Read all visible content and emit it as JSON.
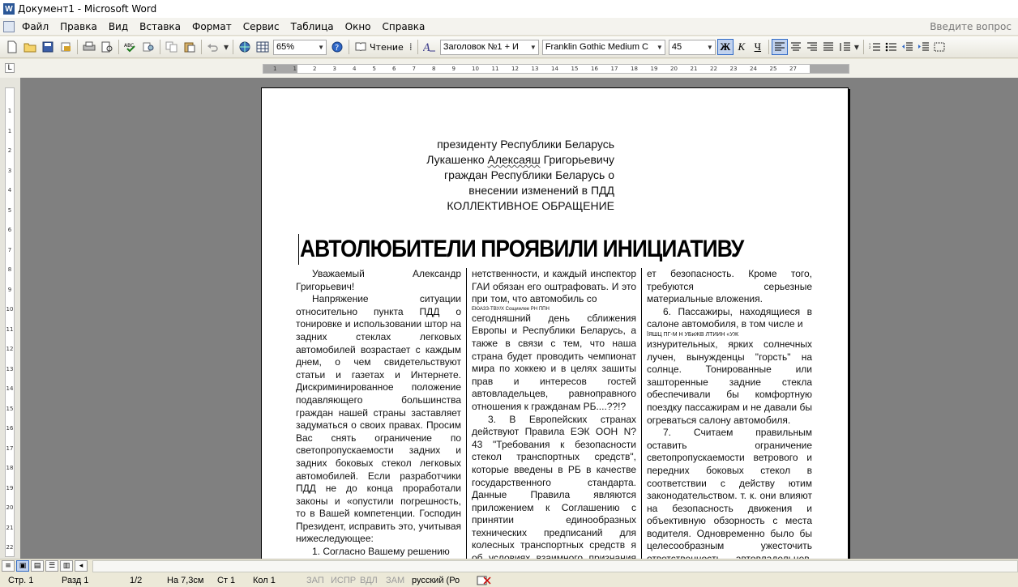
{
  "window": {
    "title": "Документ1 - Microsoft Word"
  },
  "menu": {
    "items": [
      "Файл",
      "Правка",
      "Вид",
      "Вставка",
      "Формат",
      "Сервис",
      "Таблица",
      "Окно",
      "Справка"
    ],
    "help_placeholder": "Введите вопрос"
  },
  "toolbar": {
    "zoom": "65%",
    "read_label": "Чтение",
    "style": "Заголовок №1 + И",
    "font": "Franklin Gothic Medium C",
    "size": "45",
    "bold": "Ж",
    "italic": "К",
    "underline": "Ч"
  },
  "ruler": {
    "ticks": [
      "1",
      "1",
      "2",
      "3",
      "4",
      "5",
      "6",
      "7",
      "8",
      "9",
      "10",
      "11",
      "12",
      "13",
      "14",
      "15",
      "16",
      "17",
      "18",
      "19",
      "20",
      "21",
      "22",
      "23",
      "24",
      "25",
      "27"
    ],
    "vticks": [
      "1",
      "1",
      "2",
      "3",
      "4",
      "5",
      "6",
      "7",
      "8",
      "9",
      "10",
      "11",
      "12",
      "13",
      "14",
      "15",
      "16",
      "17",
      "18",
      "19",
      "20",
      "21",
      "22"
    ]
  },
  "document": {
    "header_lines": [
      "президенту Республики Беларусь",
      "Лукашенко Алексаяш Григорьевичу",
      "граждан Республики Беларусь о",
      "внесении изменений в ПДД",
      "КОЛЛЕКТИВНОЕ ОБРАЩЕНИЕ"
    ],
    "headline": "АВТОЛЮБИТЕЛИ ПРОЯВИЛИ ИНИЦИАТИВУ",
    "col1": {
      "p1": "Уважаемый Александр Григорьевич!",
      "p2": "Напряжение ситуации относительно пункта ПДД о тонировке и использовании штор на задних стеклах легковых автомобилей возрастает с каждым днем, о чем свидетельствуют статьи и газетах и Интернете. Дискриминированное положение подавляющего большинства граждан нашей страны заставляет задуматься о своих правах. Просим Вас снять ограничение по светопропускаемости задних и задних боковых стекол легковых автомобилей. Если разработчики ПДД не до конца проработали законы и «опустили погрешность, то в Вашей компетенции. Господин Президент, исправить это, учитывая нижеследующее:",
      "p3": "1. Согласно Вашему решению"
    },
    "col2": {
      "p1": "нетственности, и каждый инспектор ГАИ обязан его оштрафовать. И это при том, что автомобиль со",
      "garbled": "ЕЮАЗЗ-ТВУ/X Сощиилее РН ППН",
      "p2": "сегодняшний день сближения Европы и Республики Беларусь, а также в связи с тем, что наша страна будет проводить чемпионат мира по хоккею и в целях зашиты прав и интересов гостей автовладельцев, равноправного отношения к гражданам РБ....??!?",
      "p3": "3. В Европейских странах действуют Правила ЕЭК ООН N? 43 \"Требования к безопасности стекол транспортных средств\", которые введены в РБ в качестве государственного стандарта. Данные Правила являются приложением к Соглашению с принятии единообразных технических предписаний для колесных транспортных средств я об условиях взаимного признания официальных утвер-"
    },
    "col3": {
      "p1": "ет безопасность. Кроме того, требуются серьезные материальные вложения.",
      "p2": "6. Пассажиры, находящиеся в салоне автомобиля, в том числе и",
      "garbled": "ЇЯШЦ ПГ-М Н УБиЖВ ЛТИИН «УЖ",
      "p3": "изнурительных, ярких солнечных лучен, вынужденцы \"горсть\" на солнце. Тонированные или зашторенные задние стекла обеспечивали бы комфортную поездку пассажирам и не давали бы огреваться салону автомобиля.",
      "p4": "7. Считаем правильным оставить ограничение светопропускаемости ветрового и передних боковых стекол в соответствии с действу ютим законодательством. т. к. они влияют на безопасность движения и объективную обзорность с места водителя. Одновременно было бы целесообразным ужесточить ответственность автовладельцев, эксплуатирующих свой автомобиль с нарушением"
    }
  },
  "status": {
    "page": "Стр. 1",
    "section": "Разд 1",
    "pages": "1/2",
    "at": "На 7,3см",
    "line": "Ст 1",
    "col": "Кол 1",
    "rec": "ЗАП",
    "trk": "ИСПР",
    "ext": "ВДЛ",
    "ovr": "ЗАМ",
    "lang": "русский (Ро"
  }
}
